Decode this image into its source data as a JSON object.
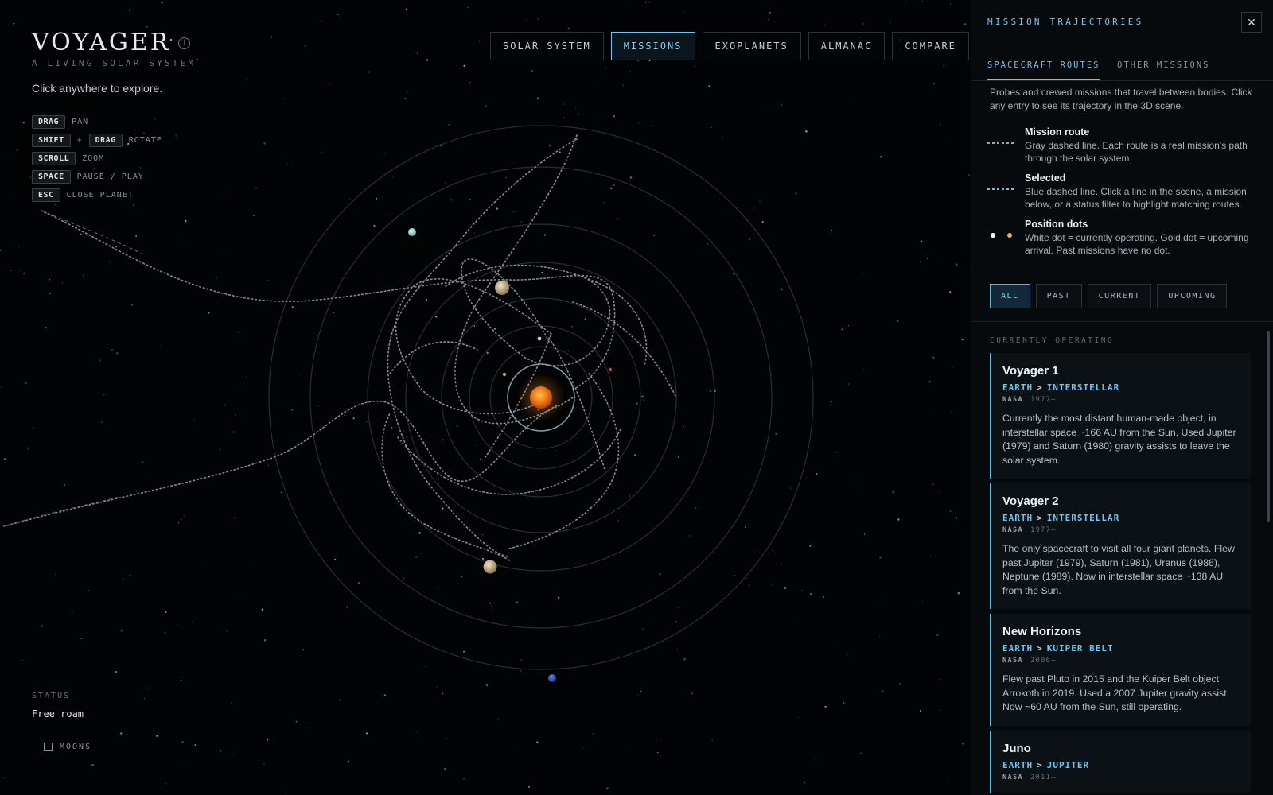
{
  "app": {
    "title": "VOYAGER",
    "subtitle": "A LIVING SOLAR SYSTEM",
    "hint": "Click anywhere to explore."
  },
  "controls": [
    {
      "keys": [
        "DRAG"
      ],
      "action": "PAN"
    },
    {
      "keys": [
        "SHIFT",
        "DRAG"
      ],
      "action": "ROTATE"
    },
    {
      "keys": [
        "SCROLL"
      ],
      "action": "ZOOM"
    },
    {
      "keys": [
        "SPACE"
      ],
      "action": "PAUSE / PLAY"
    },
    {
      "keys": [
        "ESC"
      ],
      "action": "CLOSE PLANET"
    }
  ],
  "nav": {
    "items": [
      {
        "label": "SOLAR SYSTEM",
        "active": false
      },
      {
        "label": "MISSIONS",
        "active": true
      },
      {
        "label": "EXOPLANETS",
        "active": false
      },
      {
        "label": "ALMANAC",
        "active": false
      },
      {
        "label": "COMPARE",
        "active": false
      }
    ]
  },
  "status": {
    "label": "STATUS",
    "value": "Free roam",
    "moons_label": "MOONS",
    "moons_checked": false
  },
  "panel": {
    "title": "MISSION TRAJECTORIES",
    "close_icon": "close-icon",
    "tabs": [
      {
        "label": "SPACECRAFT ROUTES",
        "active": true
      },
      {
        "label": "OTHER MISSIONS",
        "active": false
      }
    ],
    "description": "Probes and crewed missions that travel between bodies. Click any entry to see its trajectory in the 3D scene.",
    "legend": [
      {
        "name": "Mission route",
        "text": "Gray dashed line. Each route is a real mission's path through the solar system.",
        "swatch": "gray-dashed"
      },
      {
        "name": "Selected",
        "text": "Blue dashed line. Click a line in the scene, a mission below, or a status filter to highlight matching routes.",
        "swatch": "blue-dashed"
      },
      {
        "name": "Position dots",
        "text": "White dot = currently operating. Gold dot = upcoming arrival. Past missions have no dot.",
        "swatch": "dots"
      }
    ],
    "filters": [
      {
        "label": "ALL",
        "active": true
      },
      {
        "label": "PAST",
        "active": false
      },
      {
        "label": "CURRENT",
        "active": false
      },
      {
        "label": "UPCOMING",
        "active": false
      }
    ],
    "section_heading": "CURRENTLY OPERATING",
    "missions": [
      {
        "name": "Voyager 1",
        "from": "EARTH",
        "to": "INTERSTELLAR",
        "agency": "NASA",
        "years": "1977–",
        "description": "Currently the most distant human-made object, in interstellar space ~166 AU from the Sun. Used Jupiter (1979) and Saturn (1980) gravity assists to leave the solar system."
      },
      {
        "name": "Voyager 2",
        "from": "EARTH",
        "to": "INTERSTELLAR",
        "agency": "NASA",
        "years": "1977–",
        "description": "The only spacecraft to visit all four giant planets. Flew past Jupiter (1979), Saturn (1981), Uranus (1986), Neptune (1989). Now in interstellar space ~138 AU from the Sun."
      },
      {
        "name": "New Horizons",
        "from": "EARTH",
        "to": "KUIPER BELT",
        "agency": "NASA",
        "years": "2006–",
        "description": "Flew past Pluto in 2015 and the Kuiper Belt object Arrokoth in 2019. Used a 2007 Jupiter gravity assist. Now ~60 AU from the Sun, still operating."
      },
      {
        "name": "Juno",
        "from": "EARTH",
        "to": "JUPITER",
        "agency": "NASA",
        "years": "2011–",
        "description": ""
      }
    ]
  },
  "colors": {
    "accent": "#6fc4ee",
    "background": "#000000",
    "panel": "#070a0d",
    "sun": "#f07a18",
    "gold_dot": "#f0b040"
  }
}
